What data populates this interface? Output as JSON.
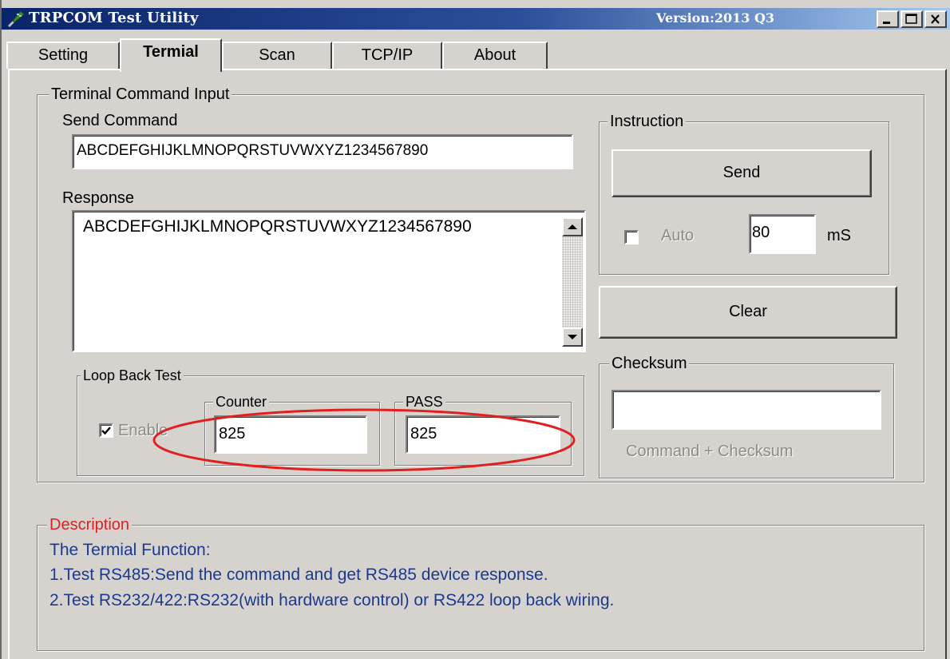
{
  "window": {
    "title": "TRPCOM Test Utility",
    "version": "Version:2013 Q3",
    "controls": {
      "minimize_icon": "minimize-icon",
      "maximize_icon": "maximize-icon",
      "close_icon": "close-icon"
    }
  },
  "tabs": [
    {
      "label": "Setting",
      "active": false
    },
    {
      "label": "Termial",
      "active": true
    },
    {
      "label": "Scan",
      "active": false
    },
    {
      "label": "TCP/IP",
      "active": false
    },
    {
      "label": "About",
      "active": false
    }
  ],
  "terminal": {
    "group_title": "Terminal Command Input",
    "send_label": "Send Command",
    "send_value": "ABCDEFGHIJKLMNOPQRSTUVWXYZ1234567890",
    "response_label": "Response",
    "response_value": "ABCDEFGHIJKLMNOPQRSTUVWXYZ1234567890"
  },
  "loopback": {
    "group_title": "Loop Back Test",
    "enable_label": "Enable",
    "enable_checked": true,
    "counter_title": "Counter",
    "counter_value": "825",
    "pass_title": "PASS",
    "pass_value": "825"
  },
  "instruction": {
    "group_title": "Instruction",
    "send_button": "Send",
    "auto_label": "Auto",
    "auto_checked": false,
    "interval_value": "80",
    "interval_unit": "mS"
  },
  "clear_button": "Clear",
  "checksum": {
    "group_title": "Checksum",
    "value": "",
    "hint": "Command + Checksum"
  },
  "description": {
    "title": "Description",
    "lines": [
      "The Termial Function:",
      "1.Test RS485:Send the command and get  RS485 device response.",
      "2.Test RS232/422:RS232(with hardware control) or RS422 loop back wiring."
    ]
  },
  "colors": {
    "title_bar": "#0a246a",
    "highlight_ellipse": "#e02020",
    "description_title": "#e02020",
    "description_text": "#1a3a8f"
  }
}
